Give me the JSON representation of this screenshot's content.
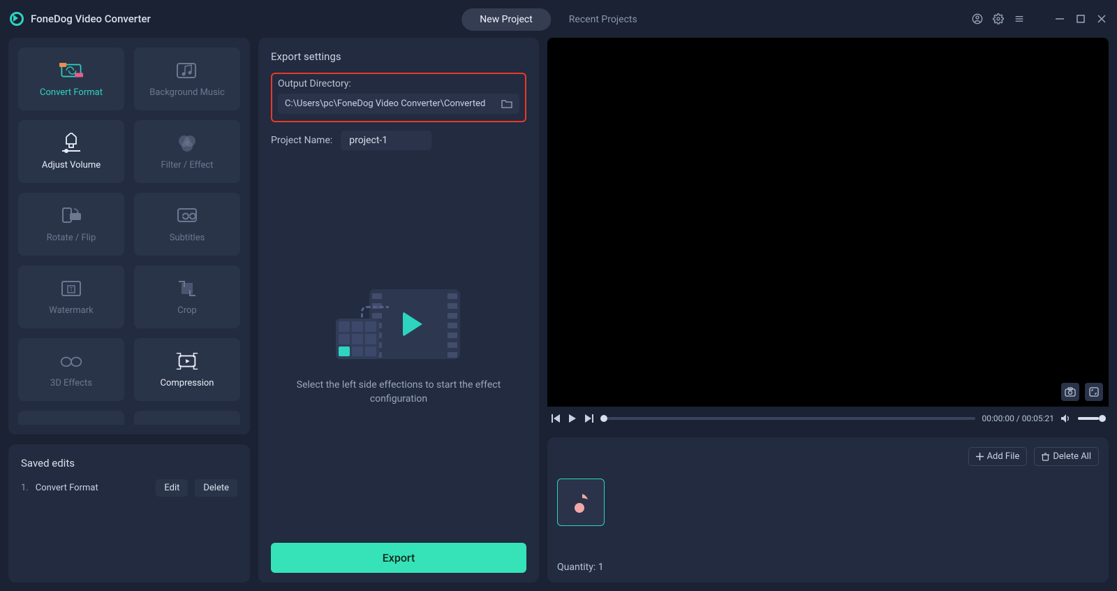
{
  "app": {
    "title": "FoneDog Video Converter"
  },
  "tabs": {
    "new_project": "New Project",
    "recent_projects": "Recent Projects"
  },
  "effects": {
    "convert_format": "Convert Format",
    "background_music": "Background Music",
    "adjust_volume": "Adjust Volume",
    "filter_effect": "Filter / Effect",
    "rotate_flip": "Rotate / Flip",
    "subtitles": "Subtitles",
    "watermark": "Watermark",
    "crop": "Crop",
    "3d_effects": "3D Effects",
    "compression": "Compression"
  },
  "saved": {
    "title": "Saved edits",
    "item_idx": "1.",
    "item_name": "Convert Format",
    "edit": "Edit",
    "delete": "Delete"
  },
  "export": {
    "section": "Export settings",
    "output_dir_label": "Output Directory:",
    "output_dir_value": "C:\\Users\\pc\\FoneDog Video Converter\\Converted",
    "proj_label": "Project Name:",
    "proj_value": "project-1",
    "hint": "Select the left side effections to start the effect configuration",
    "button": "Export"
  },
  "player": {
    "time": "00:00:00 / 00:05:21"
  },
  "files": {
    "add": "Add File",
    "delete_all": "Delete All",
    "quantity": "Quantity: 1"
  }
}
